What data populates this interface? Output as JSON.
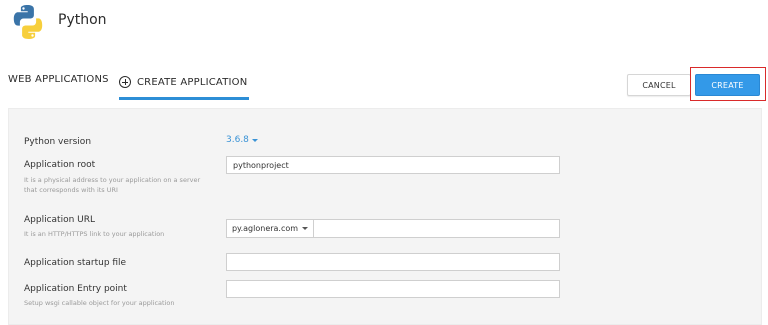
{
  "app": {
    "title": "Python"
  },
  "tabs": [
    {
      "label": "WEB APPLICATIONS"
    },
    {
      "label": "CREATE APPLICATION"
    }
  ],
  "actions": {
    "cancel_label": "CANCEL",
    "create_label": "CREATE"
  },
  "form": {
    "python_version": {
      "label": "Python version",
      "value": "3.6.8"
    },
    "app_root": {
      "label": "Application root",
      "hint": "It is a physical address to your application on a server that corresponds with its URI",
      "value": "pythonproject"
    },
    "app_url": {
      "label": "Application URL",
      "hint": "It is an HTTP/HTTPS link to your application",
      "domain": "py.aglonera.com",
      "path": ""
    },
    "startup_file": {
      "label": "Application startup file",
      "value": ""
    },
    "entry_point": {
      "label": "Application Entry point",
      "hint": "Setup wsgi callable object for your application",
      "value": ""
    }
  },
  "colors": {
    "accent": "#3399e8",
    "highlight": "#d92a2a",
    "panel": "#f4f4f4"
  },
  "icons": {
    "logo": "python-logo",
    "create_tab": "plus-circle-icon",
    "dropdown": "caret-down-icon"
  }
}
